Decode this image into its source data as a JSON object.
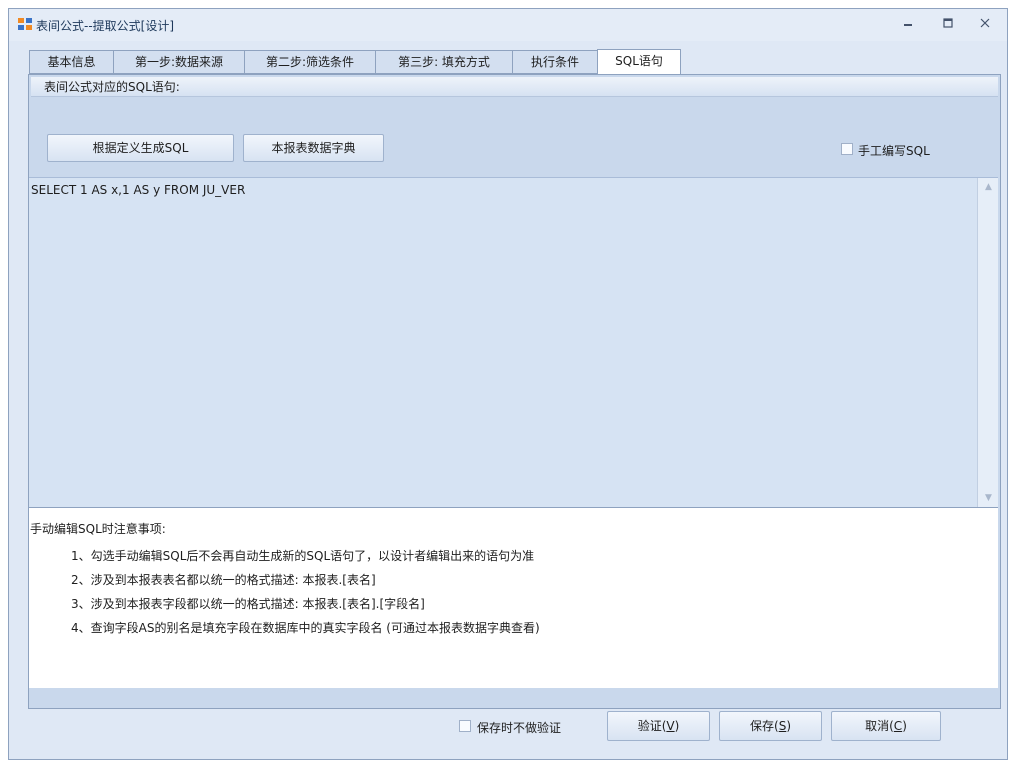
{
  "window": {
    "title": "表间公式--提取公式[设计]",
    "controls": [
      "minimize-icon",
      "maximize-icon",
      "close-icon"
    ]
  },
  "tabs": [
    {
      "label": "基本信息",
      "active": false
    },
    {
      "label": "第一步:数据来源",
      "active": false
    },
    {
      "label": "第二步:筛选条件",
      "active": false
    },
    {
      "label": "第三步: 填充方式",
      "active": false
    },
    {
      "label": "执行条件",
      "active": false
    },
    {
      "label": "SQL语句",
      "active": true
    }
  ],
  "panel": {
    "header": "表间公式对应的SQL语句:",
    "generate_button": "根据定义生成SQL",
    "dictionary_button": "本报表数据字典",
    "manual_checkbox_label": "手工编写SQL",
    "manual_checked": false,
    "sql_text": "SELECT 1 AS x,1 AS y FROM JU_VER"
  },
  "notes": {
    "title": "手动编辑SQL时注意事项:",
    "items": [
      "1、勾选手动编辑SQL后不会再自动生成新的SQL语句了，以设计者编辑出来的语句为准",
      "2、涉及到本报表表名都以统一的格式描述: 本报表.[表名]",
      "3、涉及到本报表字段都以统一的格式描述: 本报表.[表名].[字段名]",
      "4、查询字段AS的别名是填充字段在数据库中的真实字段名 (可通过本报表数据字典查看)"
    ]
  },
  "footer": {
    "no_validate_label": "保存时不做验证",
    "no_validate_checked": false,
    "validate_button": {
      "text": "验证(",
      "key": "V",
      "end": ")"
    },
    "save_button": {
      "text": "保存(",
      "key": "S",
      "end": ")"
    },
    "cancel_button": {
      "text": "取消(",
      "key": "C",
      "end": ")"
    }
  },
  "colors": {
    "window_bg": "#dfe8f5",
    "border": "#8ea2bf",
    "sql_bg": "#d6e3f3"
  }
}
